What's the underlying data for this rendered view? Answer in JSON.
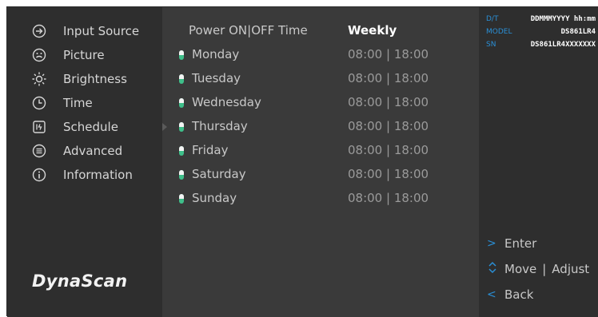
{
  "sidebar": {
    "items": [
      {
        "label": "Input Source",
        "icon": "input-source-icon"
      },
      {
        "label": "Picture",
        "icon": "picture-icon"
      },
      {
        "label": "Brightness",
        "icon": "brightness-icon"
      },
      {
        "label": "Time",
        "icon": "clock-icon"
      },
      {
        "label": "Schedule",
        "icon": "schedule-icon"
      },
      {
        "label": "Advanced",
        "icon": "advanced-icon"
      },
      {
        "label": "Information",
        "icon": "info-icon"
      }
    ],
    "logo": "DynaScan"
  },
  "main": {
    "header_left": "Power ON|OFF Time",
    "header_right": "Weekly",
    "selected_day": "Thursday",
    "days": [
      {
        "label": "Monday",
        "time": "08:00 | 18:00"
      },
      {
        "label": "Tuesday",
        "time": "08:00 | 18:00"
      },
      {
        "label": "Wednesday",
        "time": "08:00 | 18:00"
      },
      {
        "label": "Thursday",
        "time": "08:00 | 18:00"
      },
      {
        "label": "Friday",
        "time": "08:00 | 18:00"
      },
      {
        "label": "Saturday",
        "time": "08:00 | 18:00"
      },
      {
        "label": "Sunday",
        "time": "08:00 | 18:00"
      }
    ]
  },
  "info": {
    "dt_label": "D/T",
    "dt_value": "DDMMMYYYY hh:mm",
    "model_label": "MODEL",
    "model_value": "DS861LR4",
    "sn_label": "SN",
    "sn_value": "DS861LR4XXXXXXX"
  },
  "hints": {
    "enter": "Enter",
    "move": "Move",
    "separator": "|",
    "adjust": "Adjust",
    "back": "Back",
    "enter_symbol": ">",
    "back_symbol": "<"
  },
  "colors": {
    "accent": "#2a8fd6",
    "indicator_green": "#3fbf8a",
    "panel_bg": "#3a3a3a",
    "sidebar_bg": "#2e2e2e"
  }
}
